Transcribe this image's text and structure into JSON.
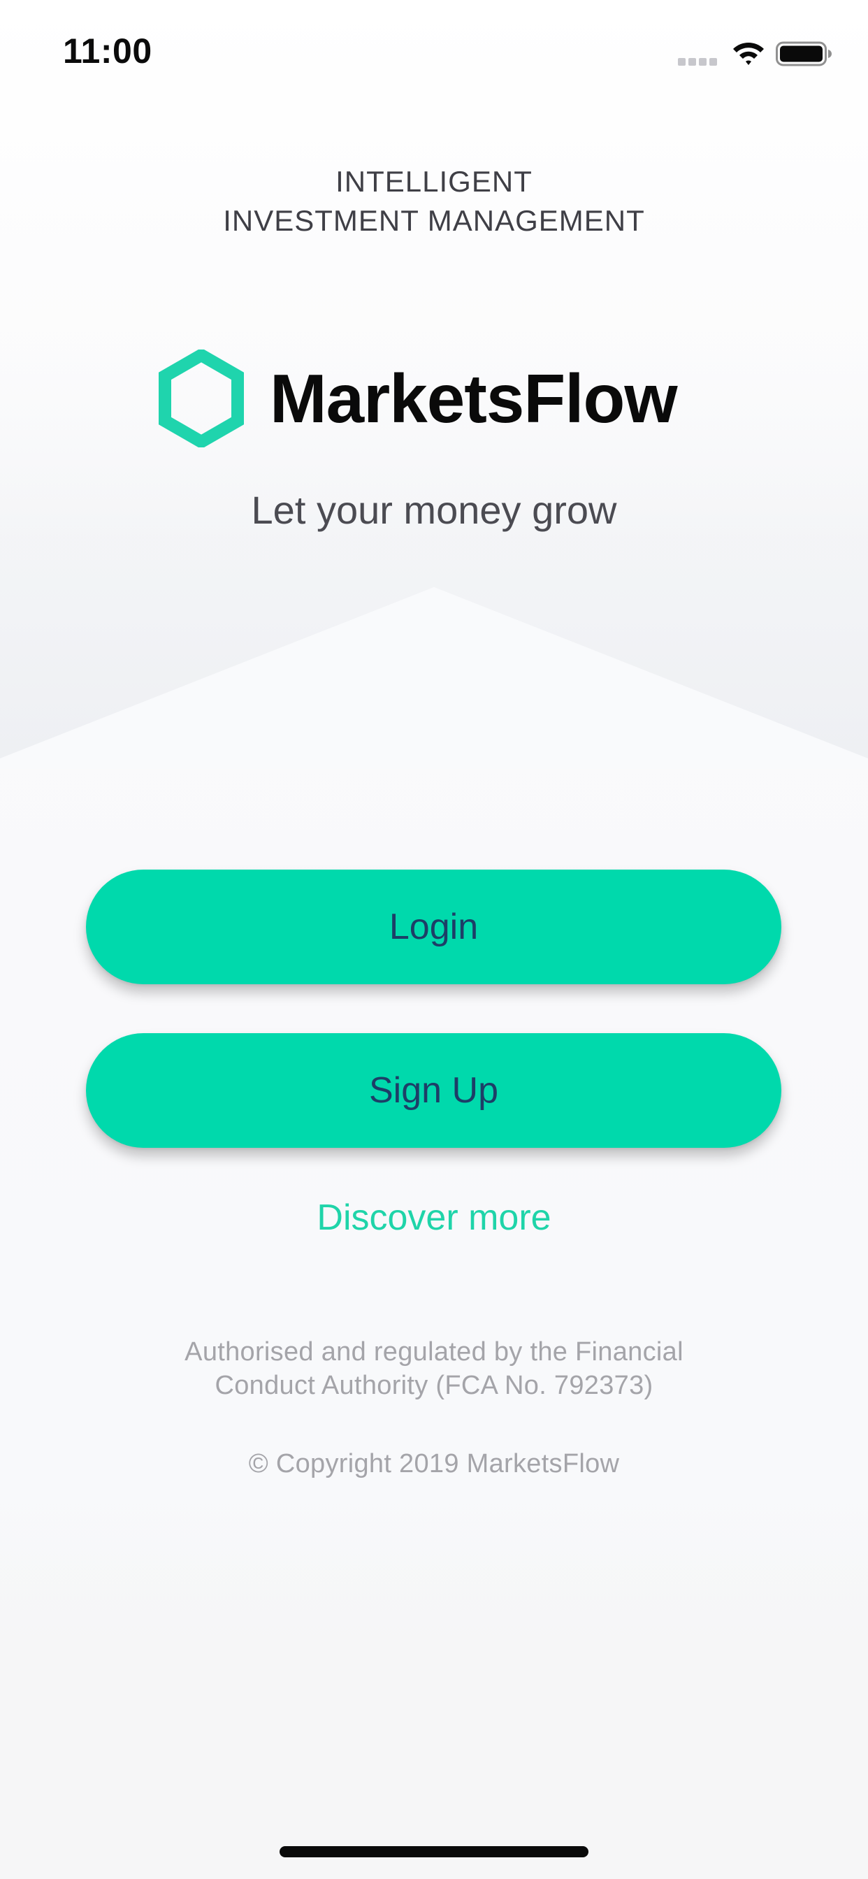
{
  "status_bar": {
    "time": "11:00"
  },
  "header": {
    "tagline_line1": "INTELLIGENT",
    "tagline_line2": "INVESTMENT MANAGEMENT"
  },
  "brand": {
    "name": "MarketsFlow",
    "logo_icon": "hexagon-icon",
    "subtitle": "Let your money grow"
  },
  "actions": {
    "login_label": "Login",
    "signup_label": "Sign Up",
    "discover_label": "Discover more"
  },
  "footer": {
    "legal_line1": "Authorised and regulated by the Financial",
    "legal_line2": "Conduct Authority (FCA No. 792373)",
    "copyright": "© Copyright 2019 MarketsFlow"
  },
  "colors": {
    "accent": "#00d9ac",
    "button_text": "#1d3e67",
    "link": "#1fd4a9",
    "muted_text": "#a4a4a9"
  }
}
